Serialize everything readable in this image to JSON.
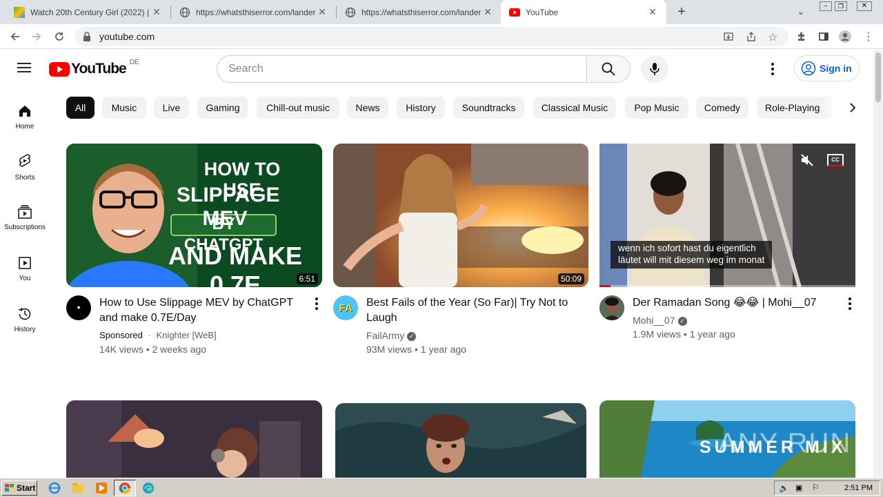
{
  "browser": {
    "tabs": [
      {
        "title": "Watch 20th Century Girl (2022) | Ko",
        "active": false
      },
      {
        "title": "https://whatsthiserror.com/landers/",
        "active": false
      },
      {
        "title": "https://whatsthiserror.com/landers/",
        "active": false
      },
      {
        "title": "YouTube",
        "active": true
      }
    ],
    "url": "youtube.com"
  },
  "youtube": {
    "logo_text": "YouTube",
    "region": "DE",
    "search_placeholder": "Search",
    "signin_label": "Sign in",
    "chips": [
      "All",
      "Music",
      "Live",
      "Gaming",
      "Chill-out music",
      "News",
      "History",
      "Soundtracks",
      "Classical Music",
      "Pop Music",
      "Comedy",
      "Role-Playing"
    ],
    "guide": [
      {
        "label": "Home",
        "icon": "home-icon"
      },
      {
        "label": "Shorts",
        "icon": "shorts-icon"
      },
      {
        "label": "Subscriptions",
        "icon": "subscriptions-icon"
      },
      {
        "label": "You",
        "icon": "you-icon"
      },
      {
        "label": "History",
        "icon": "history-icon"
      }
    ],
    "videos": [
      {
        "title_line1": "How to Use Slippage MEV by ChatGPT",
        "title_line2": "and make 0.7E/Day",
        "sponsored": "Sponsored",
        "channel": "Knighter [WeB]",
        "stats": "14K views • 2 weeks ago",
        "duration": "6:51",
        "thumb_text": [
          "HOW TO USE",
          "SLIPPAGE MEV",
          "BY CHATGPT",
          "AND MAKE 0.7E"
        ]
      },
      {
        "title_line1": "Best Fails of the Year (So Far)| Try Not to",
        "title_line2": "Laugh",
        "channel": "FailArmy",
        "stats": "93M views • 1 year ago",
        "duration": "50:09",
        "avatar_text": "FA"
      },
      {
        "title_line1": "Der Ramadan Song 😂😂 | Mohi__07",
        "channel": "Mohi__07",
        "stats": "1.9M views • 1 year ago",
        "caption_line1": "wenn ich sofort hast du eigentlich",
        "caption_line2": "läutet will mit diesem weg im monat",
        "cc_label": "CC"
      }
    ],
    "row2_thumb_text": "SUMMER MIX",
    "watermark": "ANY RUN"
  },
  "taskbar": {
    "start_label": "Start",
    "time": "2:51 PM"
  }
}
